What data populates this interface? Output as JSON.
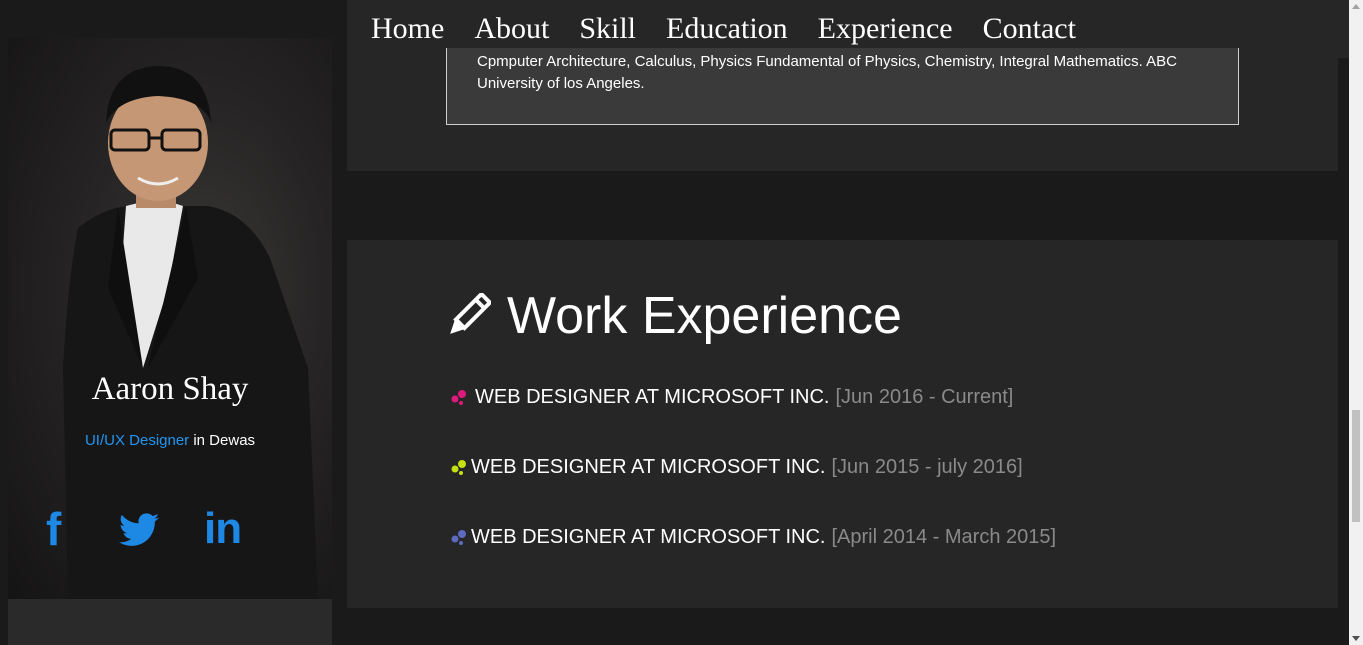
{
  "nav": {
    "items": [
      "Home",
      "About",
      "Skill",
      "Education",
      "Experience",
      "Contact"
    ]
  },
  "profile": {
    "name": "Aaron Shay",
    "role": "UI/UX Designer",
    "location_text": " in Dewas",
    "social": {
      "facebook": "f",
      "twitter": "twitter-icon",
      "linkedin": "in"
    }
  },
  "education": {
    "text": "Cpmputer Architecture, Calculus, Physics Fundamental of Physics, Chemistry, Integral Mathematics. ABC University of los Angeles."
  },
  "work": {
    "title": "Work Experience",
    "title_icon": "pencil-icon",
    "jobs": [
      {
        "title": "WEB DESIGNER AT MICROSOFT INC.",
        "period": "[Jun 2016 - Current]",
        "dot_color": "#e0197d"
      },
      {
        "title": "WEB DESIGNER AT MICROSOFT INC.",
        "period": "[Jun 2015 - july 2016]",
        "dot_color": "#c6e012"
      },
      {
        "title": "WEB DESIGNER AT MICROSOFT INC.",
        "period": "[April 2014 - March 2015]",
        "dot_color": "#5c6bc0"
      }
    ]
  },
  "colors": {
    "accent": "#1e88e5",
    "background": "#1a1a1a",
    "panel": "#262626"
  }
}
